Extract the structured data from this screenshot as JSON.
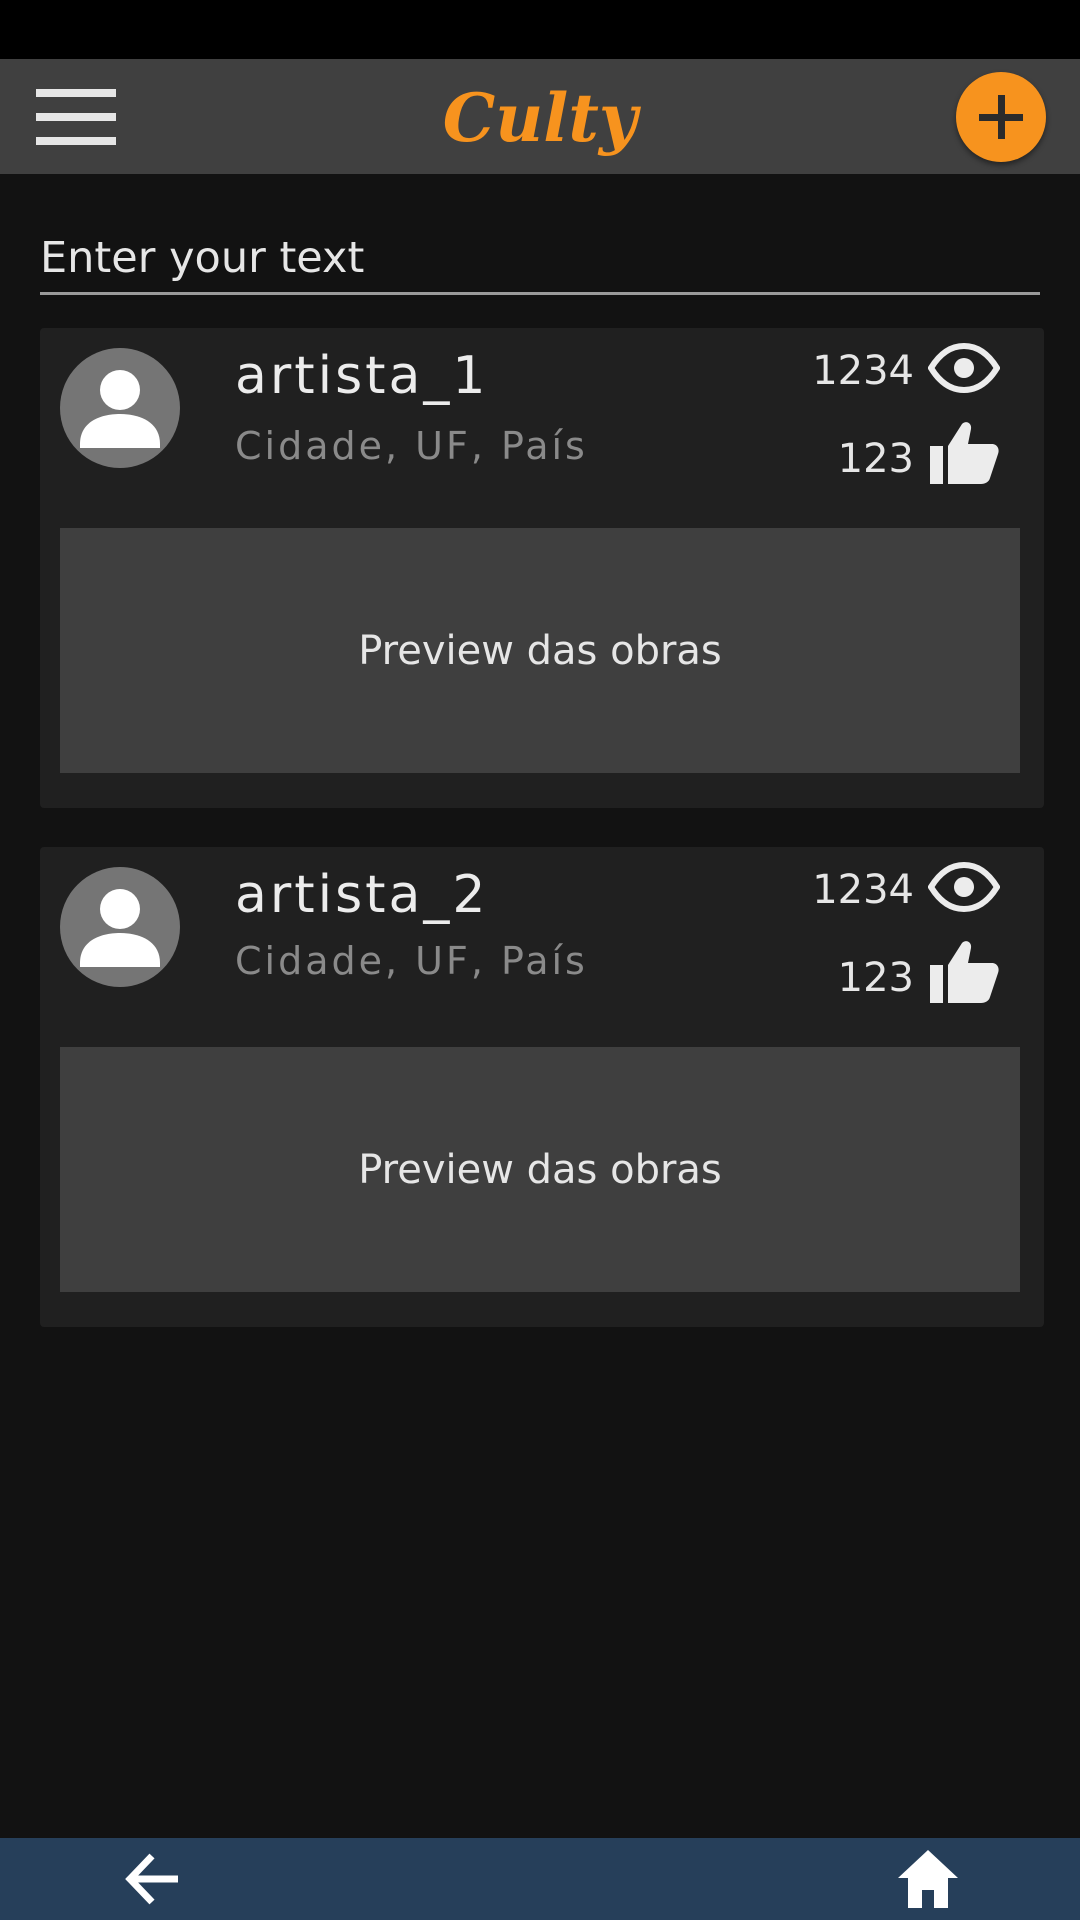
{
  "app": {
    "title": "Culty",
    "accent_color": "#f7931e",
    "menu_icon": "hamburger-menu-icon",
    "add_icon": "plus-icon"
  },
  "search": {
    "placeholder": "Enter your text",
    "value": ""
  },
  "artists": [
    {
      "name": "artista_1",
      "location": "Cidade, UF, País",
      "views": "1234",
      "likes": "123",
      "preview_label": "Preview das obras"
    },
    {
      "name": "artista_2",
      "location": "Cidade, UF, País",
      "views": "1234",
      "likes": "123",
      "preview_label": "Preview das obras"
    }
  ],
  "bottom_nav": {
    "back_icon": "arrow-left-icon",
    "home_icon": "home-icon",
    "background_color": "#263f5a"
  }
}
